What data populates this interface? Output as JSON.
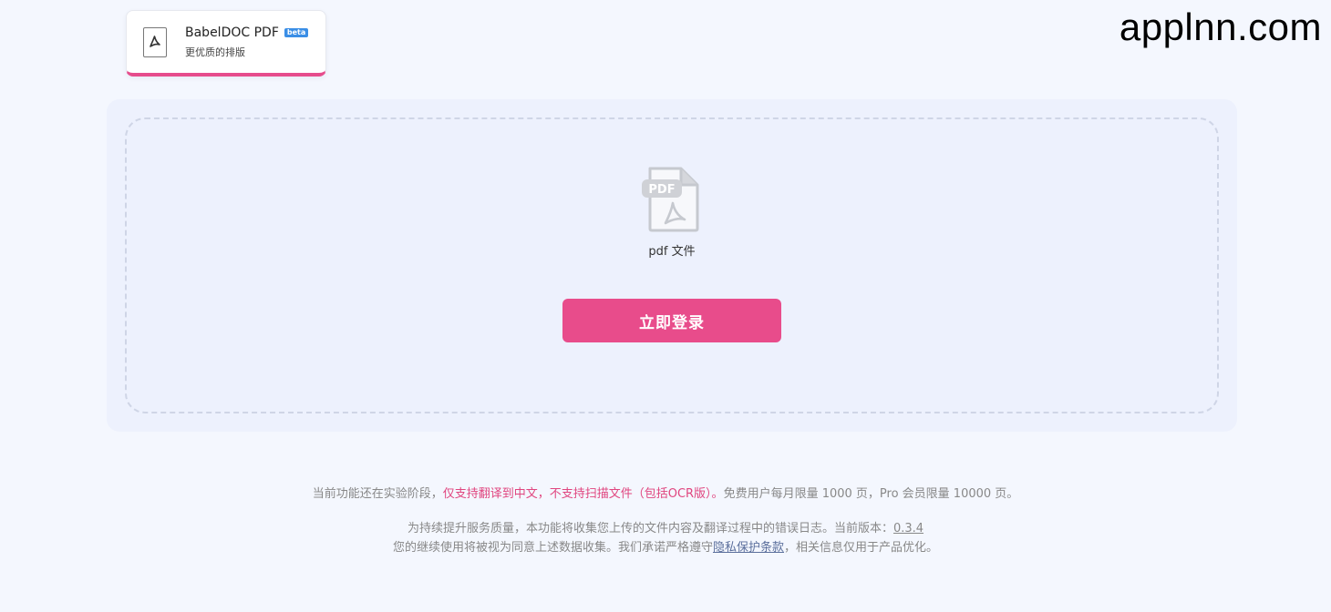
{
  "watermark": "applnn.com",
  "mode_tab": {
    "title": "BabelDOC PDF",
    "badge": "beta",
    "subtitle": "更优质的排版",
    "icon": "acrobat-pdf-icon"
  },
  "upload": {
    "icon": "pdf-file-icon",
    "icon_label": "PDF",
    "file_label": "pdf 文件",
    "login_button": "立即登录"
  },
  "notice": {
    "line1_a": "当前功能还在实验阶段，",
    "line1_b": "仅支持翻译到中文，不支持扫描文件（包括OCR版）。",
    "line1_c": "免费用户每月限量 1000 页，Pro 会员限量 10000 页。",
    "line2_a": "为持续提升服务质量，本功能将收集您上传的文件内容及翻译过程中的错误日志。当前版本：",
    "version": "0.3.4",
    "line3_a": "您的继续使用将被视为同意上述数据收集。我们承诺严格遵守",
    "privacy_link": "隐私保护条款",
    "line3_b": "，相关信息仅用于产品优化。"
  },
  "colors": {
    "accent": "#e84c8b",
    "badge": "#3a8ee6",
    "background": "#f4f7fe",
    "panel": "#edf1fd"
  }
}
